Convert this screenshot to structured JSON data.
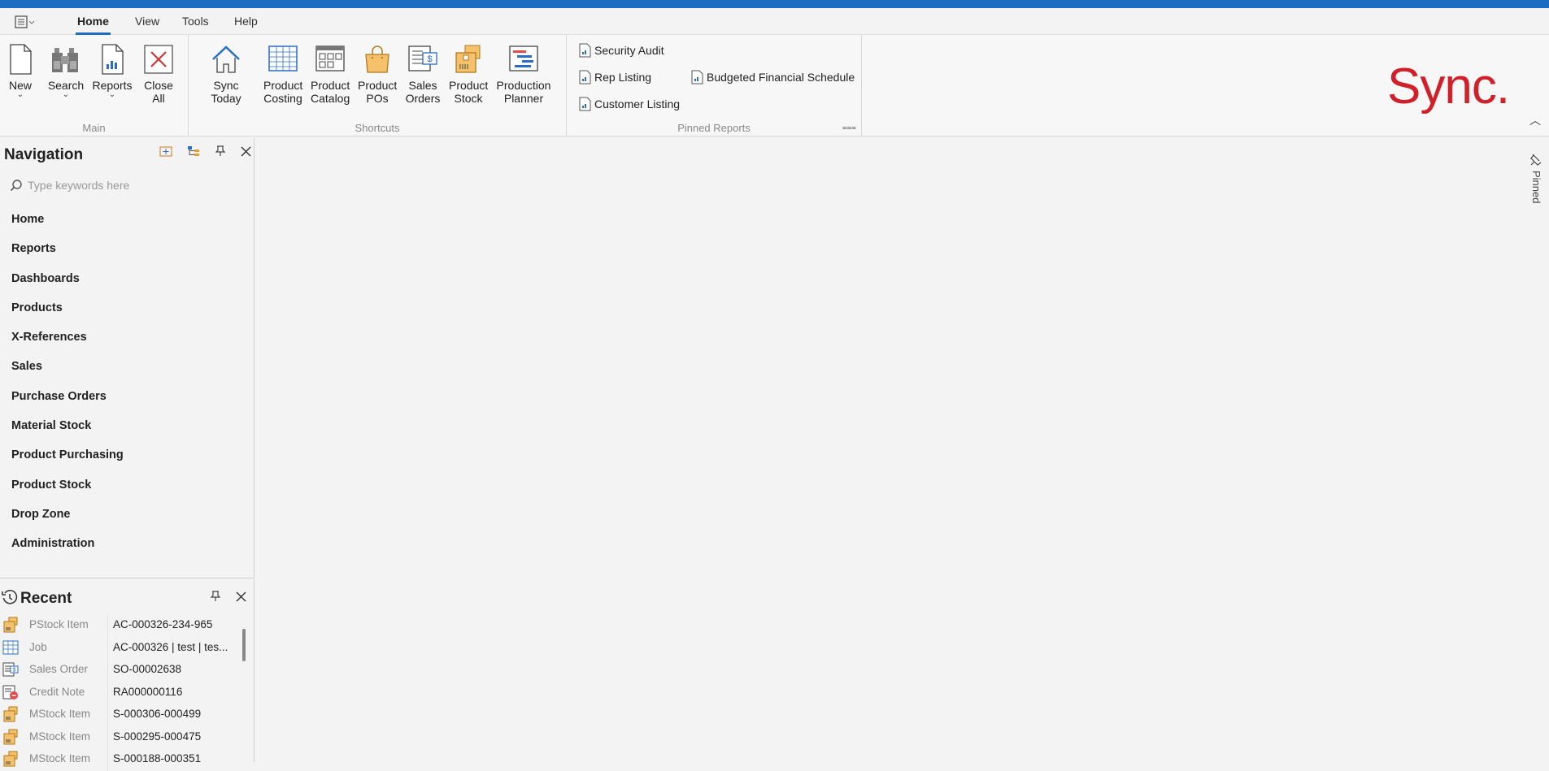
{
  "menubar": {
    "tabs": [
      "Home",
      "View",
      "Tools",
      "Help"
    ],
    "active_tab": "Home"
  },
  "ribbon": {
    "main_group": {
      "label": "Main",
      "buttons": [
        {
          "l1": "New",
          "l2": ""
        },
        {
          "l1": "Search",
          "l2": ""
        },
        {
          "l1": "Reports",
          "l2": ""
        },
        {
          "l1": "Close",
          "l2": "All"
        }
      ]
    },
    "shortcuts_group": {
      "label": "Shortcuts",
      "buttons": [
        {
          "l1": "Sync Today",
          "l2": ""
        },
        {
          "l1": "Product",
          "l2": "Costing"
        },
        {
          "l1": "Product",
          "l2": "Catalog"
        },
        {
          "l1": "Product",
          "l2": "POs"
        },
        {
          "l1": "Sales",
          "l2": "Orders"
        },
        {
          "l1": "Product",
          "l2": "Stock"
        },
        {
          "l1": "Production",
          "l2": "Planner"
        }
      ]
    },
    "pinned_reports_group": {
      "label": "Pinned Reports",
      "reports": [
        "Security Audit",
        "Rep Listing",
        "Customer Listing",
        "Budgeted Financial Schedule"
      ]
    },
    "logo_text": "Sync."
  },
  "navigation": {
    "title": "Navigation",
    "search_placeholder": "Type keywords here",
    "items": [
      "Home",
      "Reports",
      "Dashboards",
      "Products",
      "X-References",
      "Sales",
      "Purchase Orders",
      "Material Stock",
      "Product Purchasing",
      "Product Stock",
      "Drop Zone",
      "Administration"
    ]
  },
  "recent": {
    "title": "Recent",
    "rows": [
      {
        "type": "PStock Item",
        "value": "AC-000326-234-965",
        "icon": "stock-box-icon"
      },
      {
        "type": "Job",
        "value": "AC-000326 | test | tes...",
        "icon": "grid-icon"
      },
      {
        "type": "Sales Order",
        "value": "SO-00002638",
        "icon": "sales-order-icon"
      },
      {
        "type": "Credit Note",
        "value": "RA000000116",
        "icon": "credit-note-icon"
      },
      {
        "type": "MStock Item",
        "value": "S-000306-000499",
        "icon": "stock-box-icon"
      },
      {
        "type": "MStock Item",
        "value": "S-000295-000475",
        "icon": "stock-box-icon"
      },
      {
        "type": "MStock Item",
        "value": "S-000188-000351",
        "icon": "stock-box-icon"
      }
    ]
  },
  "side": {
    "pinned_label": "Pinned"
  },
  "colors": {
    "accent": "#1c6cc2",
    "brand": "#d0202a"
  }
}
